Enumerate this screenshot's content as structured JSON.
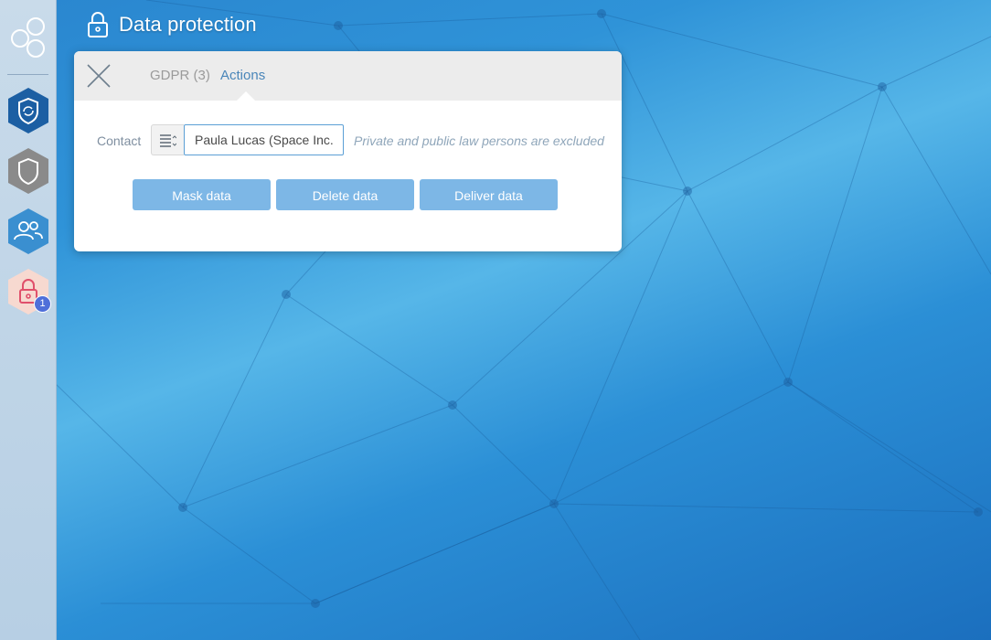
{
  "page": {
    "title": "Data protection",
    "title_icon": "padlock-icon"
  },
  "sidebar": {
    "logo": "hexagon-cluster-logo",
    "items": [
      {
        "name": "shield-sync",
        "icon": "shield-sync-icon",
        "color": "#1c5fa3"
      },
      {
        "name": "shield",
        "icon": "shield-icon",
        "color": "#8a8a8a"
      },
      {
        "name": "users",
        "icon": "users-icon",
        "color": "#3a8fd0"
      },
      {
        "name": "lock",
        "icon": "lock-icon",
        "color": "#f7d9d0",
        "badge": "1"
      }
    ]
  },
  "panel": {
    "tabs": [
      {
        "label": "GDPR (3)"
      },
      {
        "label": "Actions"
      }
    ],
    "contact_label": "Contact",
    "contact_value": "Paula Lucas (Space Inc.)",
    "hint": "Private and public law persons are excluded",
    "buttons": {
      "mask": "Mask data",
      "delete": "Delete data",
      "deliver": "Deliver data"
    }
  },
  "colors": {
    "accent": "#7db7e6",
    "active_tab": "#4a86b9"
  }
}
